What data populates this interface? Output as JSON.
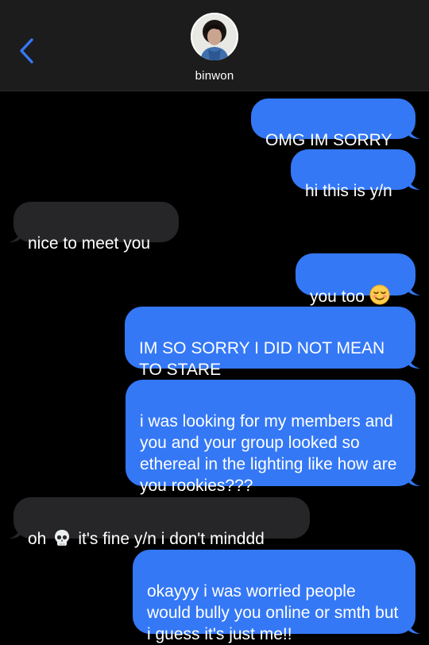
{
  "header": {
    "contact_name": "binwon",
    "back_icon": "chevron-left-icon",
    "accent": "#3478f6"
  },
  "messages": [
    {
      "from": "me",
      "text": "OMG IM SORRY"
    },
    {
      "from": "me",
      "text": "hi this is y/n"
    },
    {
      "from": "them",
      "text": "nice to meet you"
    },
    {
      "from": "me",
      "text": "you too",
      "emoji": "relieved-face-emoji"
    },
    {
      "from": "me",
      "text": "IM SO SORRY I DID NOT MEAN TO STARE"
    },
    {
      "from": "me",
      "text": "i was looking for my members and you and your group looked so ethereal in the lighting like how are you rookies???"
    },
    {
      "from": "them",
      "text_before": "oh",
      "emoji": "skull-emoji",
      "text_after": "it's fine y/n i don't minddd"
    },
    {
      "from": "me",
      "text": "okayyy i was worried people would bully you online or smth but i guess it's just me!!"
    }
  ],
  "colors": {
    "sent_bubble": "#3478f6",
    "received_bubble": "#262628",
    "header_bg": "#1c1c1d",
    "background": "#000000"
  }
}
